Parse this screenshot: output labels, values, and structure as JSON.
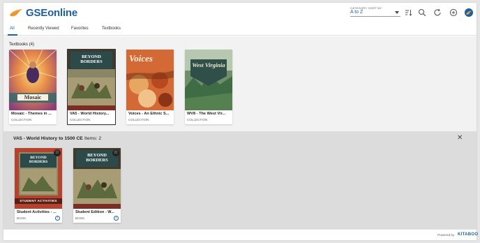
{
  "app": {
    "brand": "GSEonline"
  },
  "header": {
    "sort_label": "CATEGORY SORT BY",
    "sort_value": "A to Z",
    "icons": [
      "sort-order-icon",
      "search-icon",
      "refresh-icon",
      "add-icon",
      "avatar"
    ]
  },
  "tabs": [
    {
      "label": "All",
      "active": true
    },
    {
      "label": "Recently Viewed",
      "active": false
    },
    {
      "label": "Favorites",
      "active": false
    },
    {
      "label": "Textbooks",
      "active": false
    }
  ],
  "section": {
    "title": "Textbooks (4)"
  },
  "collections": [
    {
      "title": "Mosaic - Themes in ...",
      "type": "COLLECTION",
      "cover_text": "Mosaic"
    },
    {
      "title": "VA5 - World History...",
      "type": "COLLECTION",
      "cover_text": "BEYOND BORDERS"
    },
    {
      "title": "Voices - An Ethnic S...",
      "type": "COLLECTION",
      "cover_text": "Voices"
    },
    {
      "title": "WV8 - The West Vir...",
      "type": "COLLECTION",
      "cover_text": "West Virginia"
    }
  ],
  "panel": {
    "title": "VA5 - World History to 1500 CE",
    "count": "Items: 2",
    "books": [
      {
        "title": "Student Activities - ...",
        "type": "BOOK",
        "cover_text": "BEYOND BORDERS",
        "banner": "STUDENT ACTIVITIES"
      },
      {
        "title": "Student Edition - W...",
        "type": "BOOK",
        "cover_text": "BEYOND BORDERS"
      }
    ]
  },
  "footer": {
    "powered_by": "Powered by",
    "vendor": "KITABOO"
  },
  "colors": {
    "brand_blue": "#1d5fa3",
    "brand_orange": "#f2a03a",
    "panel_bg": "#dcdcdc",
    "content_bg": "#f2f2f2"
  }
}
